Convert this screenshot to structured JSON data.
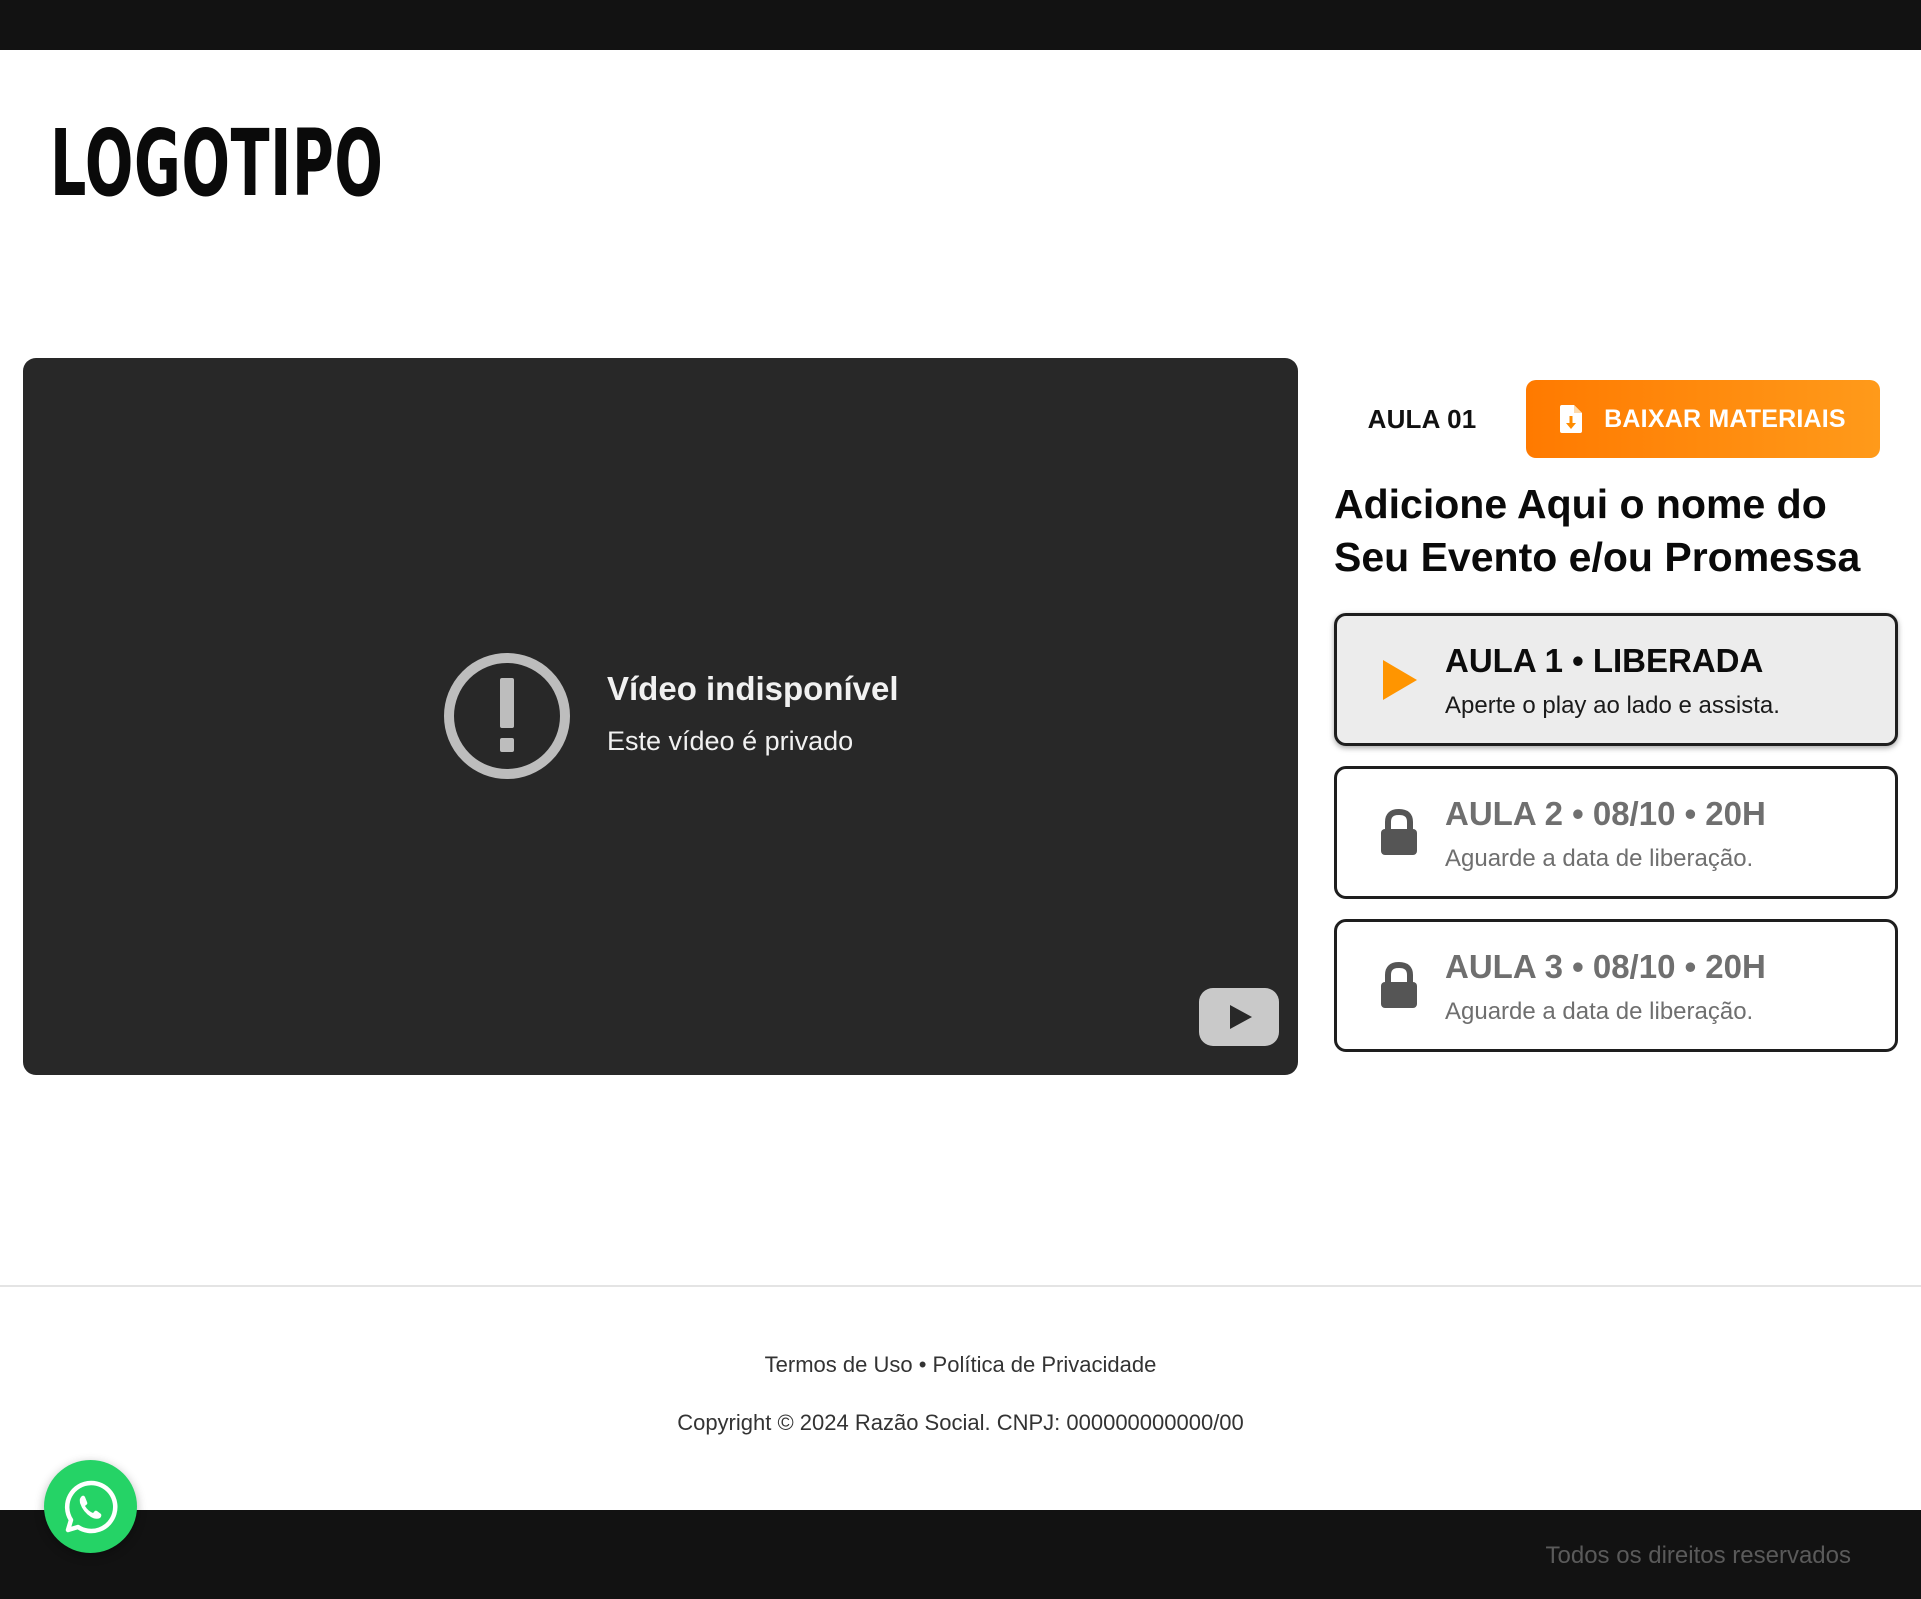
{
  "header": {
    "logo_text": "LOGOTIPO"
  },
  "video": {
    "title": "Vídeo indisponível",
    "subtitle": "Este vídeo é privado",
    "icon": "alert-circle-icon",
    "brand_icon": "youtube-icon"
  },
  "sidebar": {
    "aula_tag": "AULA 01",
    "download_label": "BAIXAR MATERIAIS",
    "download_icon": "file-download-icon",
    "event_title": "Adicione Aqui o nome do Seu Evento e/ou Promessa",
    "lessons": [
      {
        "title": "AULA 1 • LIBERADA",
        "subtitle": "Aperte o play ao lado e assista.",
        "status": "liberada",
        "icon": "play-icon"
      },
      {
        "title": "AULA 2 • 08/10 • 20H",
        "subtitle": "Aguarde a data de liberação.",
        "status": "locked",
        "icon": "lock-icon"
      },
      {
        "title": "AULA 3 • 08/10 • 20H",
        "subtitle": "Aguarde a data de liberação.",
        "status": "locked",
        "icon": "lock-icon"
      }
    ]
  },
  "footer": {
    "terms": "Termos de Uso",
    "separator": "•",
    "privacy": "Política de Privacidade",
    "copyright": "Copyright © 2024 Razão Social. CNPJ: 000000000000/00",
    "rights": "Todos os direitos reservados"
  },
  "colors": {
    "accent": "#ff8c00",
    "dark_bar": "#121212",
    "video_bg": "#282828",
    "whatsapp": "#25d366"
  }
}
